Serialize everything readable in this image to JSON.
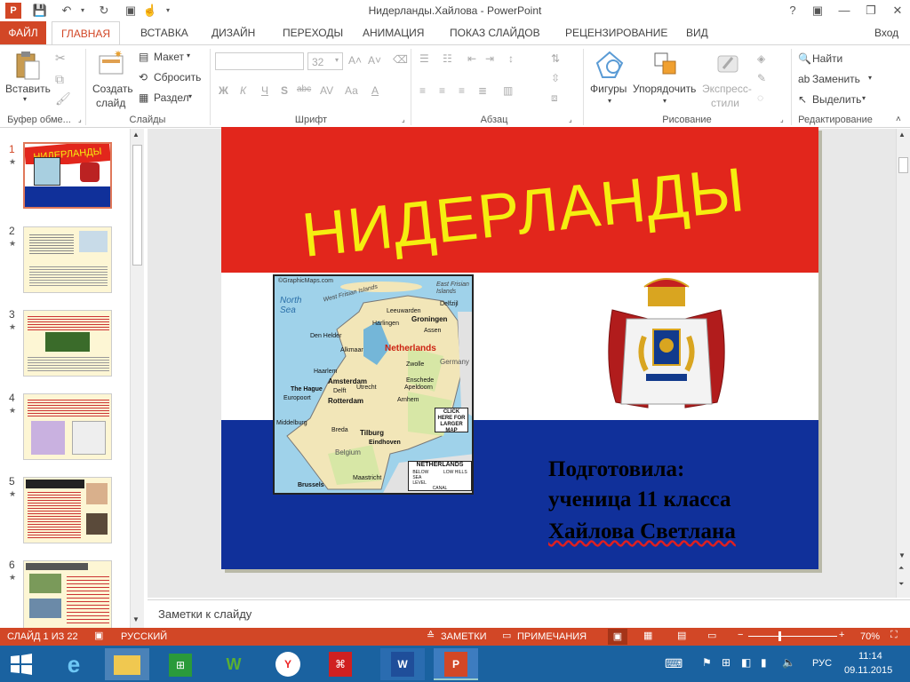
{
  "window": {
    "title": "Нидерланды.Хайлова - PowerPoint",
    "help": "?",
    "sign_in": "Вход"
  },
  "tabs": [
    {
      "label": "ФАЙЛ"
    },
    {
      "label": "ГЛАВНАЯ"
    },
    {
      "label": "ВСТАВКА"
    },
    {
      "label": "ДИЗАЙН"
    },
    {
      "label": "ПЕРЕХОДЫ"
    },
    {
      "label": "АНИМАЦИЯ"
    },
    {
      "label": "ПОКАЗ СЛАЙДОВ"
    },
    {
      "label": "РЕЦЕНЗИРОВАНИЕ"
    },
    {
      "label": "ВИД"
    }
  ],
  "ribbon": {
    "clipboard": {
      "paste": "Вставить",
      "group": "Буфер обме..."
    },
    "slides": {
      "new_slide_1": "Создать",
      "new_slide_2": "слайд",
      "layout": "Макет",
      "reset": "Сбросить",
      "section": "Раздел",
      "group": "Слайды"
    },
    "font": {
      "size": "32",
      "bold": "Ж",
      "italic": "К",
      "underline": "Ч",
      "strike": "S",
      "abc": "abc",
      "spacing": "AV",
      "case": "Аа",
      "group": "Шрифт"
    },
    "paragraph": {
      "group": "Абзац"
    },
    "drawing": {
      "shapes": "Фигуры",
      "arrange": "Упорядочить",
      "quick_1": "Экспресс-",
      "quick_2": "стили",
      "group": "Рисование"
    },
    "editing": {
      "find": "Найти",
      "replace": "Заменить",
      "select": "Выделить",
      "group": "Редактирование"
    }
  },
  "thumbnails": [
    {
      "num": "1"
    },
    {
      "num": "2"
    },
    {
      "num": "3"
    },
    {
      "num": "4"
    },
    {
      "num": "5"
    },
    {
      "num": "6"
    }
  ],
  "slide": {
    "title": "НИДЕРЛАНДЫ",
    "author_1": "Подготовила:",
    "author_2": "ученица 11 класса",
    "author_3": "Хайлова Светлана",
    "map": {
      "credit": "©GraphicMaps.com",
      "sea": "North Sea",
      "islands": "West Frisian Islands",
      "east_islands": "East Frisian Islands",
      "country": "Netherlands",
      "germany": "Germany",
      "belgium": "Belgium",
      "legend": "NETHERLANDS",
      "below": "BELOW SEA LEVEL",
      "low_hills": "LOW HILLS",
      "canal": "CANAL",
      "click": "CLICK HERE FOR LARGER MAP",
      "cities": [
        "Den Helder",
        "Leeuwarden",
        "Groningen",
        "Harlingen",
        "Alkmaar",
        "Haarlem",
        "Amsterdam",
        "Utrecht",
        "The Hague",
        "Rotterdam",
        "Delft",
        "Middelburg",
        "Breda",
        "Tilburg",
        "Eindhoven",
        "Maastricht",
        "Zwolle",
        "Enschede",
        "Arnhem",
        "Apeldoorn",
        "Brussels",
        "Europoort",
        "Assen",
        "Delfzijl"
      ]
    }
  },
  "notes": {
    "placeholder": "Заметки к слайду"
  },
  "status": {
    "slide": "СЛАЙД 1 ИЗ 22",
    "lang": "РУССКИЙ",
    "notes": "ЗАМЕТКИ",
    "comments": "ПРИМЕЧАНИЯ",
    "zoom": "70%"
  },
  "taskbar": {
    "time": "11:14",
    "date": "09.11.2015",
    "lang": "РУС"
  },
  "colors": {
    "accent": "#d24726",
    "flag_red": "#e2261c",
    "flag_blue": "#10309a",
    "title_yellow": "#f5ee10"
  }
}
